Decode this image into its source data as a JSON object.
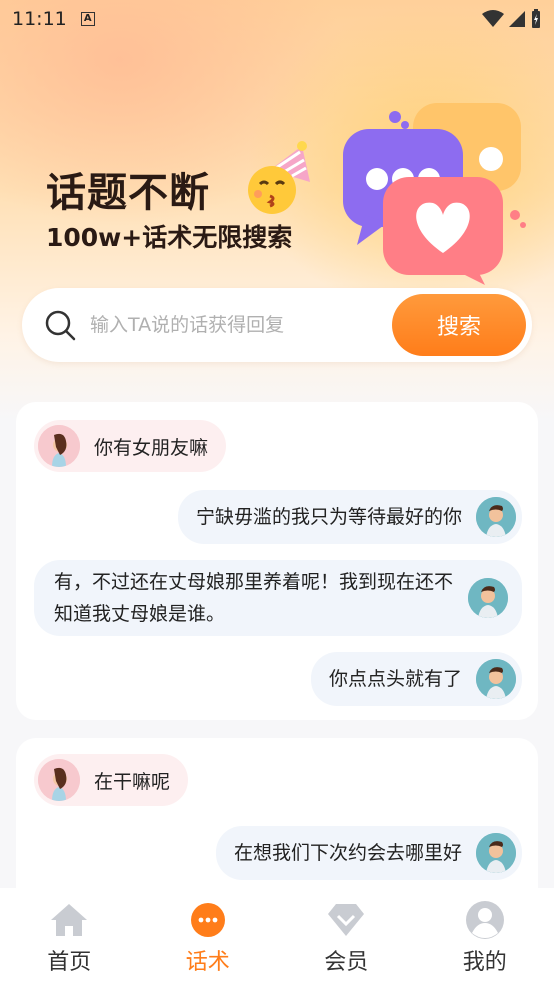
{
  "status_bar": {
    "time": "11:11",
    "badge": "A"
  },
  "banner": {
    "title": "话题不断",
    "subtitle": "100w+话术无限搜索"
  },
  "search": {
    "placeholder": "输入TA说的话获得回复",
    "button_label": "搜索"
  },
  "cards": [
    {
      "question": "你有女朋友嘛",
      "replies": [
        "宁缺毋滥的我只为等待最好的你",
        "有，不过还在丈母娘那里养着呢！我到现在还不知道我丈母娘是谁。",
        "你点点头就有了"
      ]
    },
    {
      "question": "在干嘛呢",
      "replies": [
        "在想我们下次约会去哪里好"
      ]
    }
  ],
  "nav": {
    "items": [
      {
        "label": "首页",
        "icon": "home-icon"
      },
      {
        "label": "话术",
        "icon": "chat-icon"
      },
      {
        "label": "会员",
        "icon": "diamond-icon"
      },
      {
        "label": "我的",
        "icon": "profile-icon"
      }
    ],
    "active": "话术"
  },
  "colors": {
    "accent": "#ff7d1a",
    "inactive_icon": "#c9ccd2"
  }
}
